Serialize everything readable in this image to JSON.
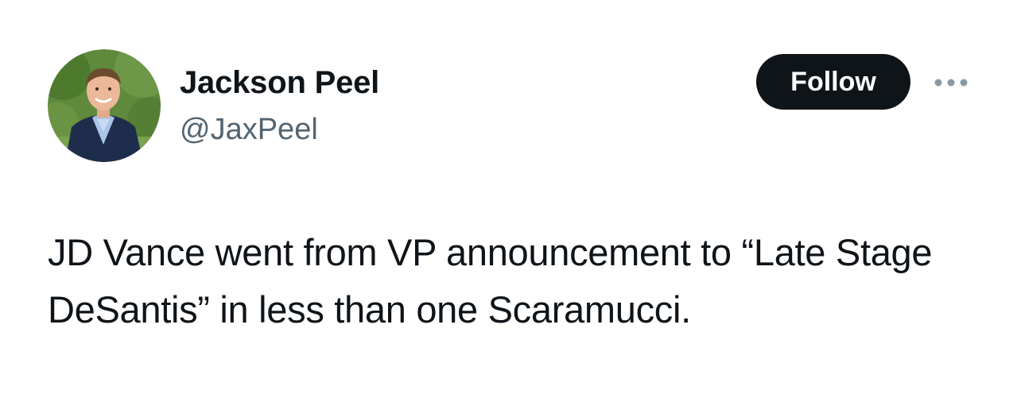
{
  "author": {
    "display_name": "Jackson Peel",
    "handle": "@JaxPeel"
  },
  "actions": {
    "follow_label": "Follow",
    "more_icon": "more-horizontal-icon"
  },
  "tweet": {
    "text": "JD Vance went from VP announcement to “Late Stage DeSantis” in less than one Scaramucci."
  },
  "colors": {
    "text_primary": "#0f1419",
    "text_secondary": "#536471",
    "follow_button_bg": "#0f1419",
    "follow_button_text": "#ffffff",
    "more_icon": "#8899a6"
  }
}
